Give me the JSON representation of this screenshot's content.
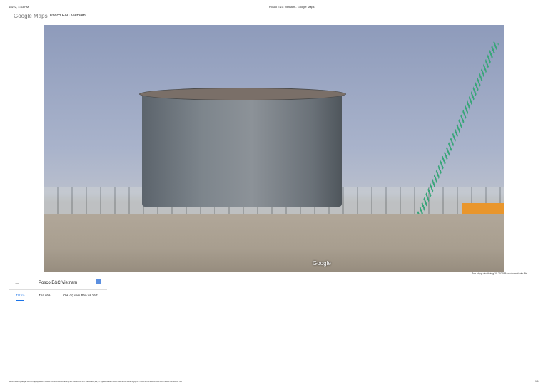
{
  "print_header": {
    "datetime": "1/5/22, 4:43 PM",
    "title": "Posco E&C Vietnam - Google Maps"
  },
  "brand": {
    "logo": "Google Maps",
    "place": "Posco E&C Vietnam"
  },
  "photo": {
    "watermark": "Google",
    "credit": "Ảnh chụp vào tháng 10 2020",
    "report": "Báo cáo một vấn đề"
  },
  "panel": {
    "title": "Posco E&C Vietnam",
    "tabs": [
      {
        "label": "Tất cả",
        "active": true
      },
      {
        "label": "Tòa nhà"
      },
      {
        "label": "Chế độ xem Phố và 360°"
      }
    ]
  },
  "print_footer": {
    "url": "https://www.google.com/maps/place/Posco+E%26C+Vietnam/@10.6101636,107.0288886,3a,37.5y,90t/data=!3m8!1e2!3m6!1sAF1QipN...!4m5!3m4!1s0x0:0x0!8m2!3d10.61!4d107.03",
    "page": "1/1"
  },
  "colors": {
    "accent": "#1a73e8"
  }
}
